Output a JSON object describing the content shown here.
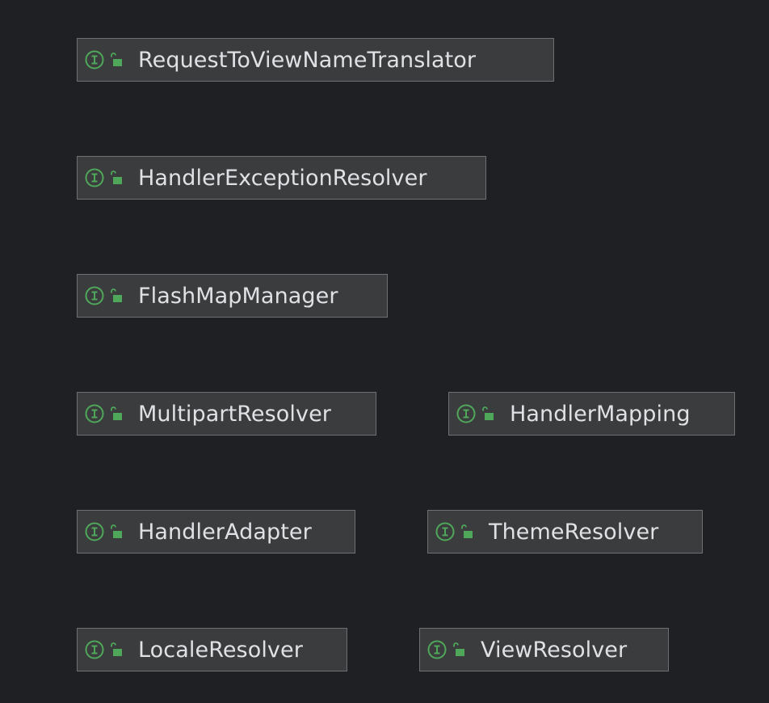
{
  "diagram": {
    "nodes": [
      {
        "id": "n1",
        "name": "RequestToViewNameTranslator",
        "kind": "interface-icon",
        "visibility": "public-icon"
      },
      {
        "id": "n2",
        "name": "HandlerExceptionResolver",
        "kind": "interface-icon",
        "visibility": "public-icon"
      },
      {
        "id": "n3",
        "name": "FlashMapManager",
        "kind": "interface-icon",
        "visibility": "public-icon"
      },
      {
        "id": "n4",
        "name": "MultipartResolver",
        "kind": "interface-icon",
        "visibility": "public-icon"
      },
      {
        "id": "n5",
        "name": "HandlerMapping",
        "kind": "interface-icon",
        "visibility": "public-icon"
      },
      {
        "id": "n6",
        "name": "HandlerAdapter",
        "kind": "interface-icon",
        "visibility": "public-icon"
      },
      {
        "id": "n7",
        "name": "ThemeResolver",
        "kind": "interface-icon",
        "visibility": "public-icon"
      },
      {
        "id": "n8",
        "name": "LocaleResolver",
        "kind": "interface-icon",
        "visibility": "public-icon"
      },
      {
        "id": "n9",
        "name": "ViewResolver",
        "kind": "interface-icon",
        "visibility": "public-icon"
      }
    ],
    "colors": {
      "background": "#1f2023",
      "node_fill": "#3b3c3e",
      "node_border": "#6e6f72",
      "icon_green": "#4fa85a",
      "text": "#dfe1e5"
    }
  }
}
